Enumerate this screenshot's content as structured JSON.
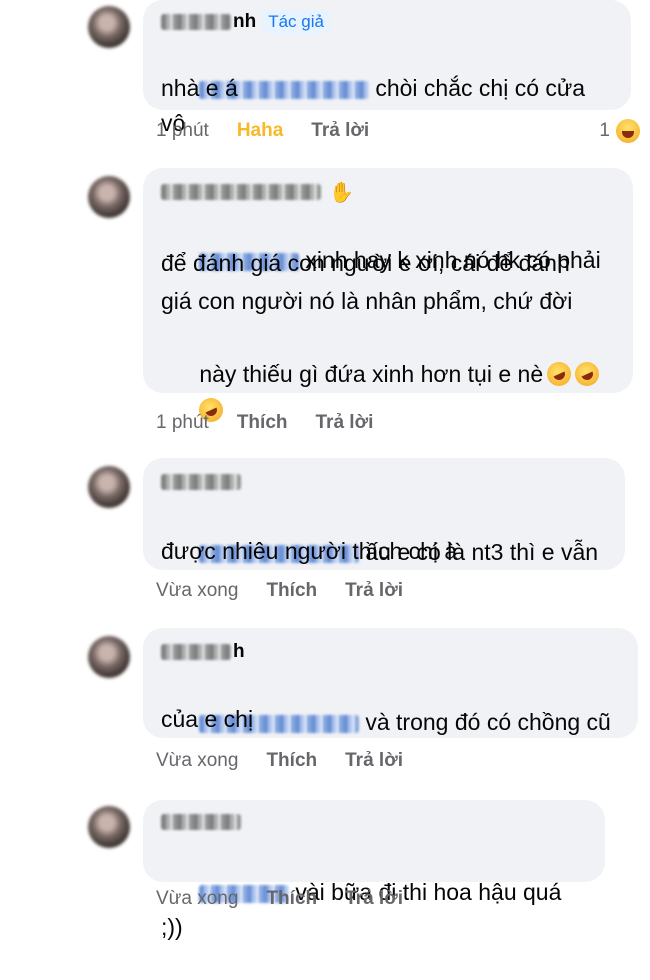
{
  "comments": [
    {
      "name_suffix": "nh",
      "badge": "Tác giả",
      "text_line1": "chòi chắc chị có cửa vô",
      "text_line2": "nhà e á",
      "time": "1 phút",
      "reaction_label": "Haha",
      "reply_label": "Trả lời",
      "reaction_count": "1",
      "reaction_icon": "laughing-emoji-icon"
    },
    {
      "name_icon": "waving-hand-icon",
      "text_line1": "xinh hay k xinh nó hk có phải",
      "text_line2": "để đánh giá con người e ơi, cái để đánh",
      "text_line3": "giá con người nó là nhân phẩm, chứ đời",
      "text_line4": "này thiếu gì đứa xinh hơn tụi e nè",
      "emoji_icon": "rolling-on-floor-laughing-emoji-icon",
      "time": "1 phút",
      "like_label": "Thích",
      "reply_label": "Trả lời"
    },
    {
      "text_line1": "ầu e có là nt3 thì e vẫn",
      "text_line2": "được nhiêu người thích chị à",
      "time": "Vừa xong",
      "like_label": "Thích",
      "reply_label": "Trả lời"
    },
    {
      "name_suffix": "h",
      "text_line1": "và trong đó có chồng cũ",
      "text_line2": "của e chị",
      "time": "Vừa xong",
      "like_label": "Thích",
      "reply_label": "Trả lời"
    },
    {
      "text_line1": "vài bữa đi thi hoa hậu quá ;))",
      "time": "Vừa xong",
      "like_label": "Thích",
      "reply_label": "Trả lời"
    }
  ],
  "colors": {
    "bubble": "#f0f2f5",
    "meta": "#65676b",
    "haha": "#f7b928",
    "badge_bg": "#e7f3ff",
    "badge_text": "#1877f2"
  }
}
